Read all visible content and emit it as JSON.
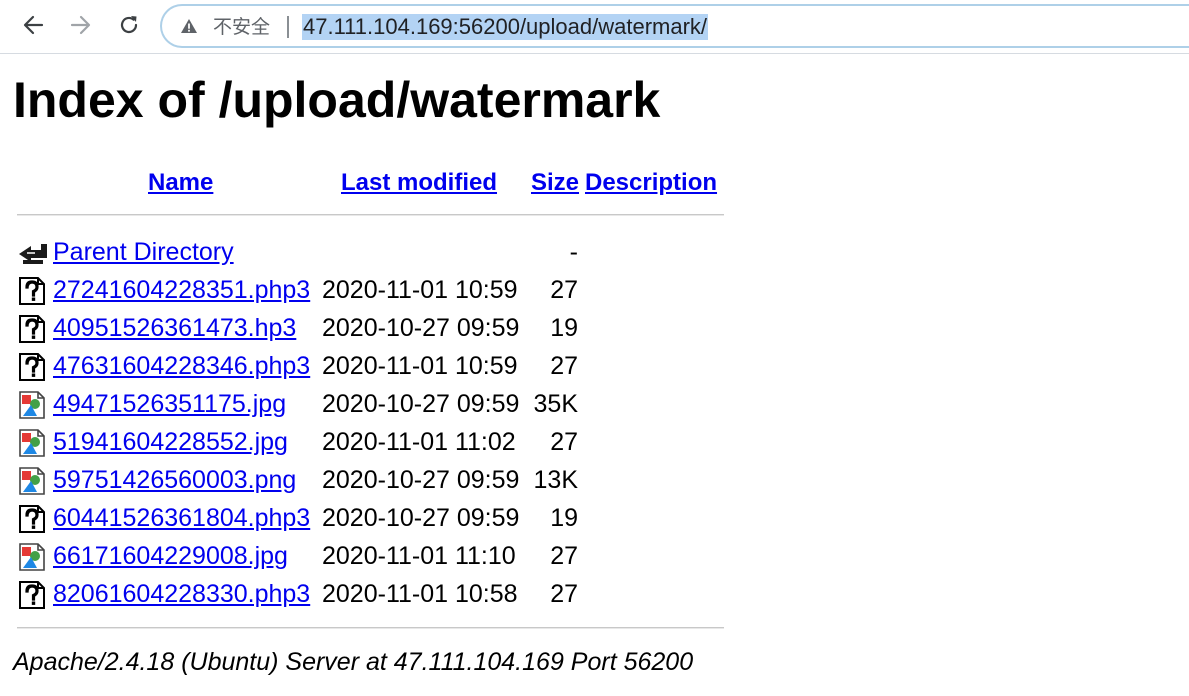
{
  "browser": {
    "security_label": "不安全",
    "url": "47.111.104.169:56200/upload/watermark/",
    "icons": {
      "back": "back-arrow-icon",
      "forward": "forward-arrow-icon",
      "reload": "reload-icon",
      "warning": "warning-icon"
    }
  },
  "page": {
    "title": "Index of /upload/watermark",
    "columns": {
      "name": "Name",
      "last_modified": "Last modified",
      "size": "Size",
      "description": "Description"
    },
    "parent": {
      "name": "Parent Directory",
      "size": "-",
      "icon": "back-folder-icon"
    },
    "files": [
      {
        "name": "27241604228351.php3",
        "modified": "2020-11-01 10:59",
        "size": "27",
        "icon": "unknown-file-icon"
      },
      {
        "name": "40951526361473.hp3",
        "modified": "2020-10-27 09:59",
        "size": "19",
        "icon": "unknown-file-icon"
      },
      {
        "name": "47631604228346.php3",
        "modified": "2020-11-01 10:59",
        "size": "27",
        "icon": "unknown-file-icon"
      },
      {
        "name": "49471526351175.jpg",
        "modified": "2020-10-27 09:59",
        "size": "35K",
        "icon": "image-file-icon"
      },
      {
        "name": "51941604228552.jpg",
        "modified": "2020-11-01 11:02",
        "size": "27",
        "icon": "image-file-icon"
      },
      {
        "name": "59751426560003.png",
        "modified": "2020-10-27 09:59",
        "size": "13K",
        "icon": "image-file-icon"
      },
      {
        "name": "60441526361804.php3",
        "modified": "2020-10-27 09:59",
        "size": "19",
        "icon": "unknown-file-icon"
      },
      {
        "name": "66171604229008.jpg",
        "modified": "2020-11-01 11:10",
        "size": "27",
        "icon": "image-file-icon"
      },
      {
        "name": "82061604228330.php3",
        "modified": "2020-11-01 10:58",
        "size": "27",
        "icon": "unknown-file-icon"
      }
    ],
    "server_signature": "Apache/2.4.18 (Ubuntu) Server at 47.111.104.169 Port 56200"
  },
  "colors": {
    "link": "#0000ee",
    "url_highlight": "#b3d3f4",
    "omnibox_border": "#aed0e8"
  }
}
